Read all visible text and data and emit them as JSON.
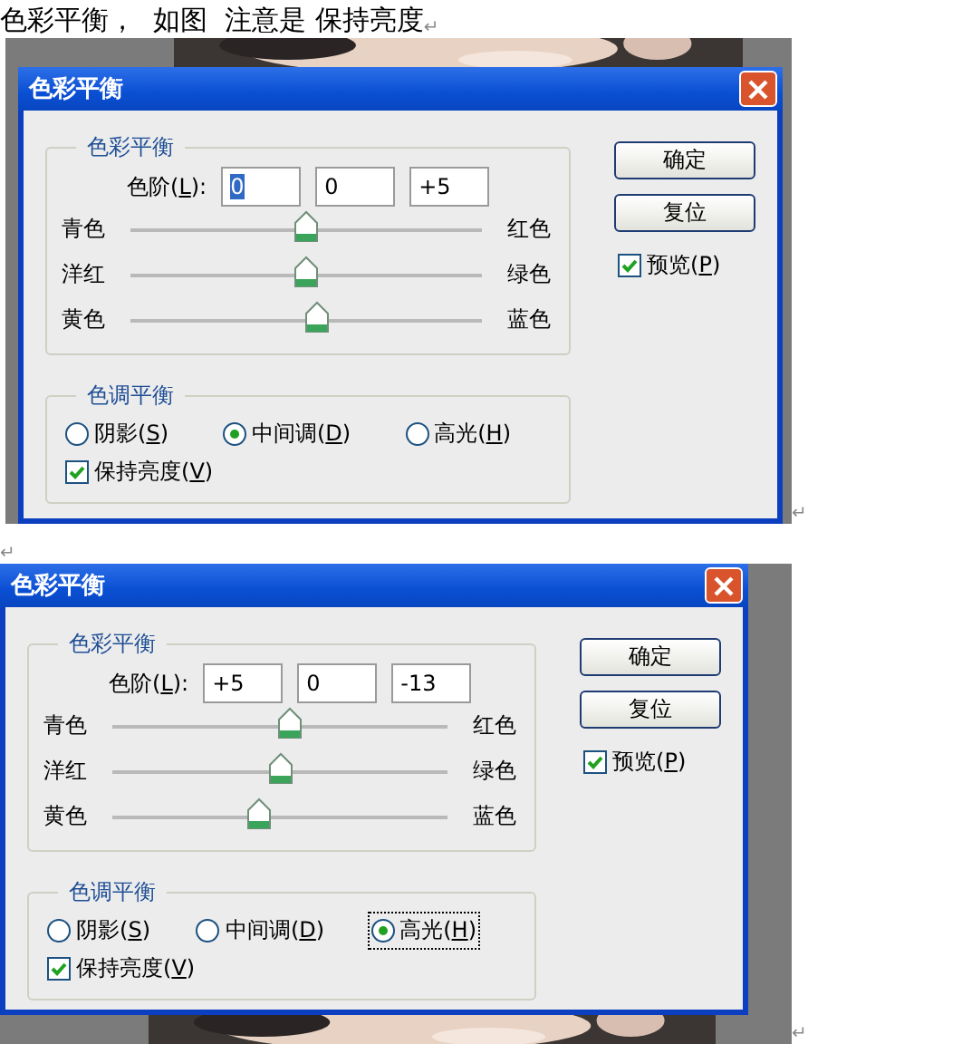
{
  "caption": {
    "text": "色彩平衡，  如图  注意是 保持亮度",
    "mark": "↵"
  },
  "figures": [
    {
      "kind": "figure_top",
      "mark": "↵",
      "dialog": {
        "title": "色彩平衡",
        "color_group": {
          "legend": "色彩平衡",
          "levels": {
            "before": "色阶(",
            "key": "L",
            "after": "):",
            "values": [
              "0",
              "0",
              "+5"
            ],
            "first_selected": true
          },
          "sliders": [
            {
              "left": "青色",
              "right": "红色",
              "level": 0.5
            },
            {
              "left": "洋红",
              "right": "绿色",
              "level": 0.5
            },
            {
              "left": "黄色",
              "right": "蓝色",
              "level": 0.53
            }
          ]
        },
        "tone_group": {
          "legend": "色调平衡",
          "radios": [
            {
              "before": "阴影(",
              "key": "S",
              "after": ")",
              "selected": false,
              "focused": false
            },
            {
              "before": "中间调(",
              "key": "D",
              "after": ")",
              "selected": true,
              "focused": false
            },
            {
              "before": "高光(",
              "key": "H",
              "after": ")",
              "selected": false,
              "focused": false
            }
          ],
          "preserve": {
            "before": "保持亮度(",
            "key": "V",
            "after": ")",
            "checked": true
          }
        },
        "buttons": [
          "确定",
          "复位"
        ],
        "preview": {
          "before": "预览(",
          "key": "P",
          "after": ")",
          "checked": true
        }
      }
    },
    {
      "kind": "empty",
      "mark": "↵"
    },
    {
      "kind": "figure_bottom",
      "mark": "↵",
      "dialog": {
        "title": "色彩平衡",
        "color_group": {
          "legend": "色彩平衡",
          "levels": {
            "before": "色阶(",
            "key": "L",
            "after": "):",
            "values": [
              "+5",
              "0",
              "-13"
            ],
            "first_selected": false
          },
          "sliders": [
            {
              "left": "青色",
              "right": "红色",
              "level": 0.53
            },
            {
              "left": "洋红",
              "right": "绿色",
              "level": 0.505
            },
            {
              "left": "黄色",
              "right": "蓝色",
              "level": 0.44
            }
          ]
        },
        "tone_group": {
          "legend": "色调平衡",
          "radios": [
            {
              "before": "阴影(",
              "key": "S",
              "after": ")",
              "selected": false,
              "focused": false
            },
            {
              "before": "中间调(",
              "key": "D",
              "after": ")",
              "selected": false,
              "focused": false
            },
            {
              "before": "高光(",
              "key": "H",
              "after": ")",
              "selected": true,
              "focused": true
            }
          ],
          "preserve": {
            "before": "保持亮度(",
            "key": "V",
            "after": ")",
            "checked": true
          }
        },
        "buttons": [
          "确定",
          "复位"
        ],
        "preview": {
          "before": "预览(",
          "key": "P",
          "after": ")",
          "checked": true
        }
      }
    }
  ]
}
